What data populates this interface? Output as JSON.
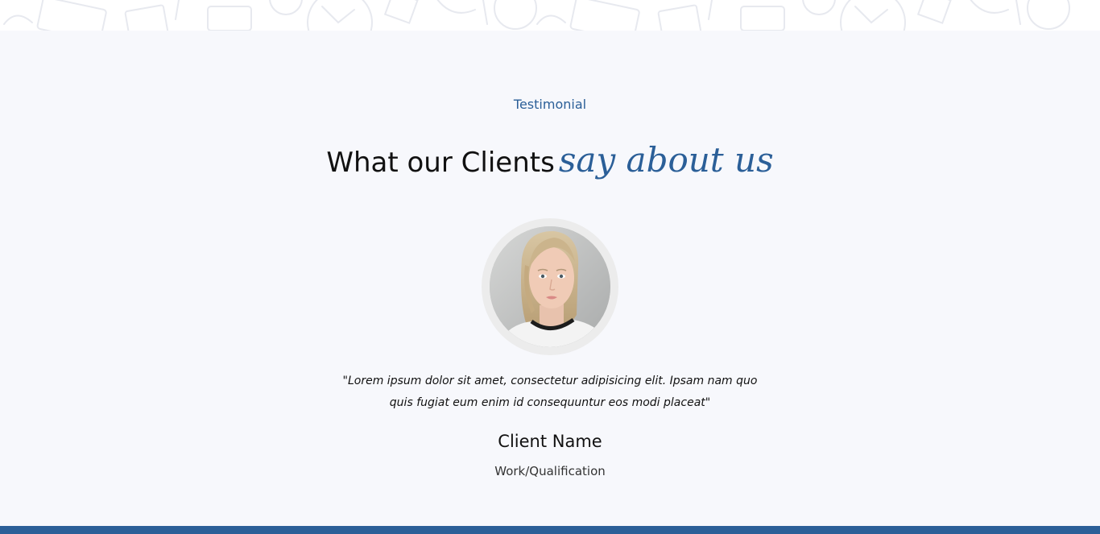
{
  "section": {
    "eyebrow": "Testimonial",
    "heading_plain": "What our Clients",
    "heading_accent": "say about us"
  },
  "testimonial": {
    "quote_line1": "\"Lorem ipsum dolor sit amet, consectetur adipisicing elit. Ipsam nam quo",
    "quote_line2": "quis fugiat eum enim id consequuntur eos modi placeat\"",
    "client_name": "Client Name",
    "client_role": "Work/Qualification",
    "avatar_icon": "client-photo"
  },
  "colors": {
    "accent": "#2b5f98",
    "section_bg": "#f7f8fc",
    "text": "#111111",
    "ring": "#ececec"
  }
}
